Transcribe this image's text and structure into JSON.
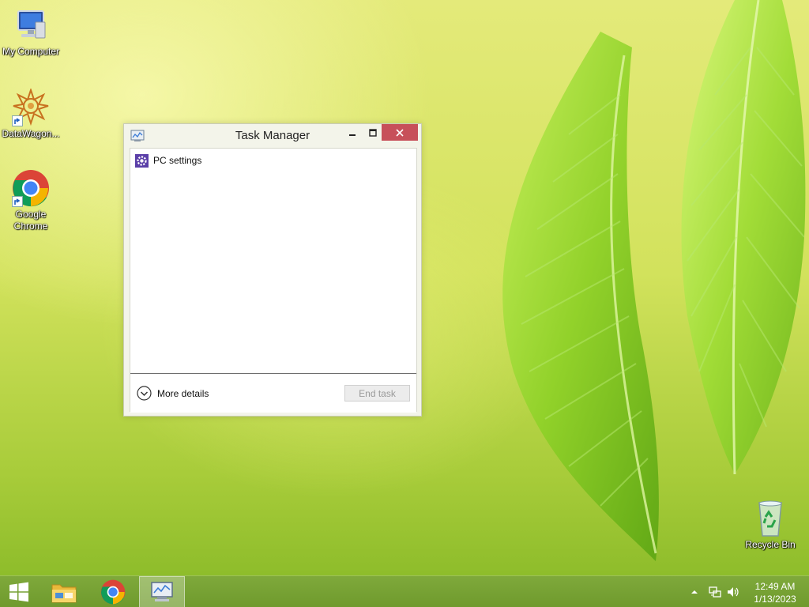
{
  "desktop": {
    "icons": [
      {
        "label": "My Computer"
      },
      {
        "label": "DataWagon..."
      },
      {
        "label": "Google Chrome"
      },
      {
        "label": "Recycle Bin"
      }
    ]
  },
  "window": {
    "title": "Task Manager",
    "processes": [
      {
        "name": "PC settings",
        "icon": "gear-icon"
      }
    ],
    "more_details_label": "More details",
    "end_task_label": "End task"
  },
  "taskbar": {
    "items": [
      {
        "icon": "windows-start-icon"
      },
      {
        "icon": "file-explorer-icon"
      },
      {
        "icon": "chrome-icon"
      },
      {
        "icon": "task-manager-icon",
        "active": true
      }
    ],
    "clock": {
      "time": "12:49 AM",
      "date": "1/13/2023"
    }
  },
  "colors": {
    "close_button": "#c7505a",
    "taskbar": "#7fa93b",
    "wallpaper_accent": "#8ecf2e"
  }
}
